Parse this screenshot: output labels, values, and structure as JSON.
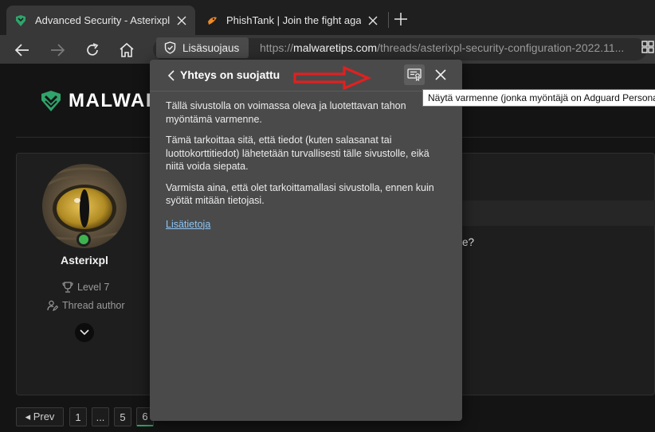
{
  "browser": {
    "tabs": [
      {
        "title": "Advanced Security - Asterixpl Security",
        "active": true,
        "icon": "malwaretips-icon"
      },
      {
        "title": "PhishTank | Join the fight against phishing",
        "active": false,
        "icon": "phishtank-icon"
      }
    ],
    "security_chip_label": "Lisäsuojaus",
    "url_prefix": "https://",
    "url_host": "malwaretips.com",
    "url_path": "/threads/asterixpl-security-configuration-2022.11..."
  },
  "page": {
    "logo_text": "MALWARE",
    "post": {
      "username": "Asterixpl",
      "level": "Level 7",
      "role": "Thread author",
      "partial_text": "e?"
    },
    "pagination": {
      "prev_label": "◂ Prev",
      "pages": [
        "1",
        "...",
        "5",
        "6"
      ]
    }
  },
  "popup": {
    "title": "Yhteys on suojattu",
    "paragraphs": [
      "Tällä sivustolla on voimassa oleva ja luotettavan tahon myöntämä varmenne.",
      "Tämä tarkoittaa sitä, että tiedot (kuten salasanat tai luottokorttitiedot) lähetetään turvallisesti tälle sivustolle, eikä niitä voida siepata.",
      "Varmista aina, että olet tarkoittamallasi sivustolla, ennen kuin syötät mitään tietojasi."
    ],
    "link": "Lisätietoja",
    "tooltip": "Näytä varmenne (jonka myöntäjä on Adguard Personal CA)"
  },
  "colors": {
    "accent_green": "#2fa36b",
    "annotation_arrow": "#e02020",
    "link": "#8ec5f5"
  }
}
